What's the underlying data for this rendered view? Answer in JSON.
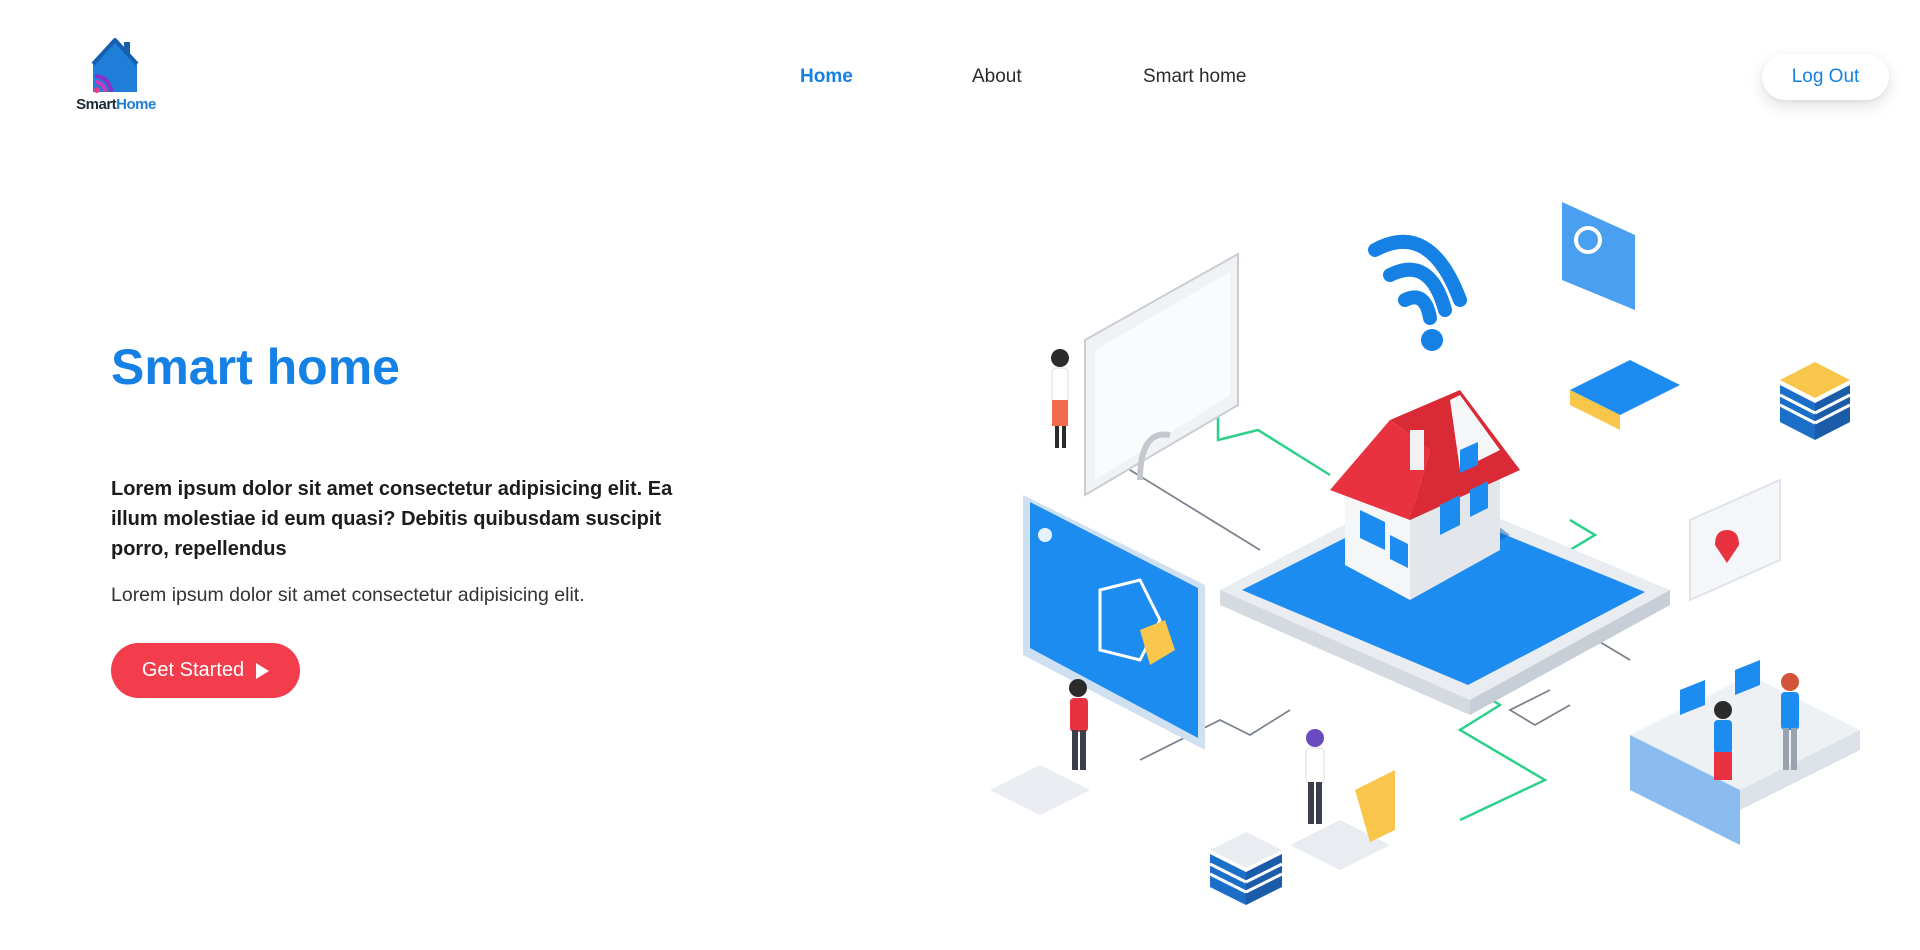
{
  "brand": {
    "name_part1": "Smart",
    "name_part2": "Home",
    "icon": "house-wifi-logo-icon"
  },
  "nav": {
    "items": [
      {
        "label": "Home",
        "active": true
      },
      {
        "label": "About",
        "active": false
      },
      {
        "label": "Smart home",
        "active": false
      }
    ]
  },
  "header": {
    "logout_label": "Log Out"
  },
  "hero": {
    "title": "Smart home",
    "lead": "Lorem ipsum dolor sit amet consectetur adipisicing elit. Ea illum molestiae id eum quasi? Debitis quibusdam suscipit porro, repellendus",
    "subtitle": "Lorem ipsum dolor sit amet consectetur adipisicing elit.",
    "cta_label": "Get Started",
    "cta_icon": "play-icon"
  },
  "illustration": {
    "icon": "isometric-smart-home-illustration"
  },
  "colors": {
    "accent": "#1681e4",
    "cta": "#f33d4c",
    "roof": "#e8323f",
    "panel_blue": "#1c8cf0"
  }
}
